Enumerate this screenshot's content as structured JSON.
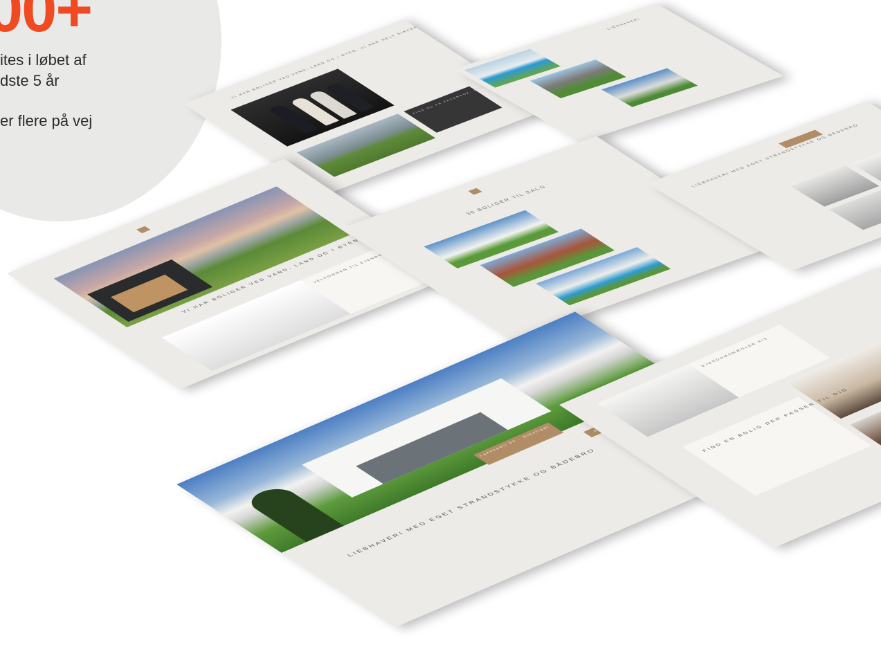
{
  "callout": {
    "number": "00+",
    "line1": "ites i løbet af",
    "line2": "dste 5 år",
    "line3": "er flere på vej"
  },
  "mockups": {
    "team_page": {
      "headline": "Vi har boliger ved vand, land og i byen, vi har helt sikkert også en bolig til dig",
      "dark_box": "Find os på Facebook, LinkedIn og Instagram"
    },
    "listing_top": {
      "label": "Liebhaveri"
    },
    "home_page": {
      "headline": "Vi har boliger ved vand, land og i byen, vi har helt sikkert også en bolig til dig",
      "welcome": "Velkommen til Ejendomsmægler A/S"
    },
    "for_sale": {
      "title": "30 boliger til salg"
    },
    "detail_page": {
      "headline": "Liebhaveri med eget strandstykke og bådebro",
      "badge": "Lakoepeli 02 · Nibeliggt",
      "cta": "Bestil salgsopstilling"
    },
    "right_top": {
      "headline": "Liebhaveri med eget strandstykke og bådebro"
    },
    "right_mid": {
      "title": "Ejendomsmægler A/S",
      "headline": "Find en bolig der passer til dig"
    }
  },
  "colors": {
    "accent": "#f04a23",
    "gold": "#b08d66",
    "page_bg": "#ecebe8"
  }
}
